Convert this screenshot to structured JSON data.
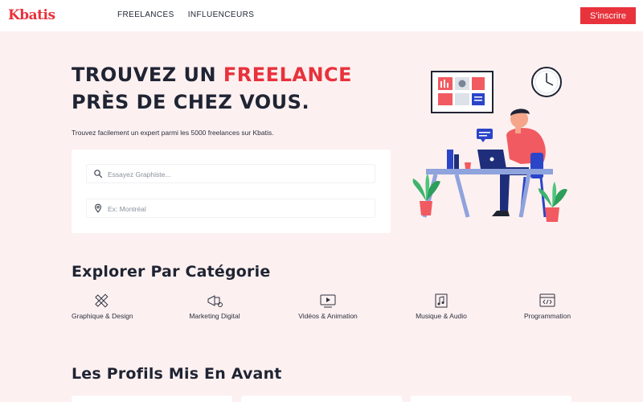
{
  "header": {
    "logo": "Kbatis",
    "nav": [
      "FREELANCES",
      "INFLUENCEURS"
    ],
    "signup_label": "S'inscrire"
  },
  "hero": {
    "title_line1_prefix": "TROUVEZ UN ",
    "title_line1_accent": "FREELANCE",
    "title_line2": "PRÈS DE CHEZ VOUS.",
    "subtitle": "Trouvez facilement un expert parmi les 5000 freelances sur Kbatis.",
    "search_placeholder": "Essayez Graphiste...",
    "location_placeholder": "Ex: Montréal"
  },
  "categories": {
    "title": "Explorer Par Catégorie",
    "items": [
      {
        "label": "Graphique & Design",
        "icon": "pencil-ruler-icon"
      },
      {
        "label": "Marketing Digital",
        "icon": "megaphone-icon"
      },
      {
        "label": "Vidéos & Animation",
        "icon": "video-play-icon"
      },
      {
        "label": "Musique & Audio",
        "icon": "music-note-icon"
      },
      {
        "label": "Programmation",
        "icon": "code-window-icon"
      }
    ]
  },
  "profiles": {
    "title": "Les Profils Mis En Avant"
  },
  "colors": {
    "accent": "#e8323c",
    "background": "#fdf0f0",
    "text": "#1f2433"
  }
}
